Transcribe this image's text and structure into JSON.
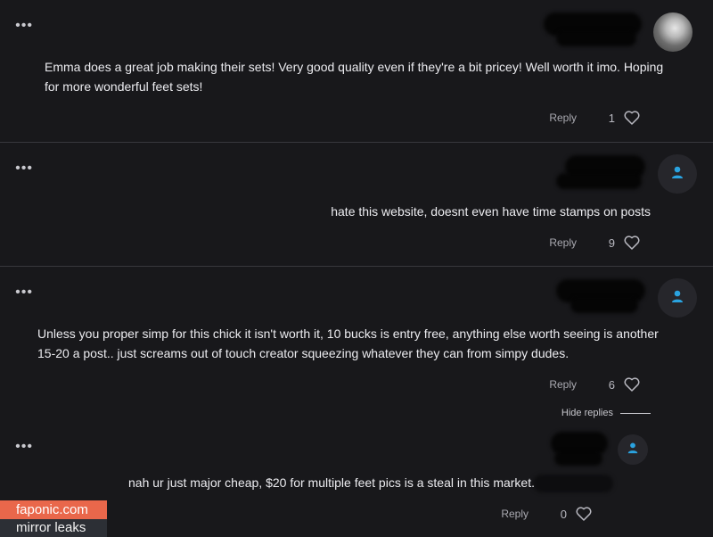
{
  "comments": [
    {
      "text": "Emma does a great job making their sets! Very good quality even if they're a bit pricey! Well worth it imo. Hoping for more wonderful feet sets!",
      "likes": "1",
      "reply_label": "Reply",
      "avatar_icon": "user-photo-icon"
    },
    {
      "text": "hate this website, doesnt even have time stamps on posts",
      "likes": "9",
      "reply_label": "Reply",
      "avatar_icon": "user-icon"
    },
    {
      "text": "Unless you proper simp for this chick it isn't worth it, 10 bucks is entry free, anything else worth seeing is another 15-20 a post.. just screams out of touch creator squeezing whatever they can from simpy dudes.",
      "likes": "6",
      "reply_label": "Reply",
      "avatar_icon": "user-icon",
      "hide_replies_label": "Hide replies"
    },
    {
      "text": "nah ur just major cheap, $20 for multiple feet pics is a steal in this market.",
      "likes": "0",
      "reply_label": "Reply",
      "avatar_icon": "user-icon"
    }
  ],
  "more_icon": "more-horizontal-icon",
  "accent": "#2aa3e0",
  "watermark": {
    "site": "faponic.com",
    "tagline": "mirror leaks"
  }
}
